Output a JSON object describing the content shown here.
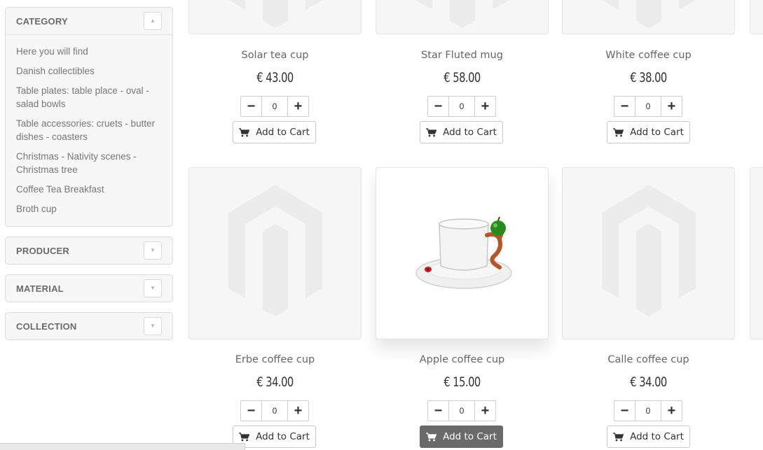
{
  "sidebar": {
    "category": {
      "title": "CATEGORY",
      "items": [
        "Here you will find",
        "Danish collectibles",
        "Table plates: table place - oval - salad bowls",
        "Table accessories: cruets - butter dishes - coasters",
        "Christmas - Nativity scenes - Christmas tree",
        "Coffee Tea Breakfast",
        "Broth cup"
      ]
    },
    "producer": {
      "title": "PRODUCER"
    },
    "material": {
      "title": "MATERIAL"
    },
    "collection": {
      "title": "COLLECTION"
    }
  },
  "products": [
    {
      "name": "Solar tea cup",
      "price": "€ 43.00",
      "qty": "0",
      "cart_label": "Add to Cart"
    },
    {
      "name": "Star Fluted mug",
      "price": "€ 58.00",
      "qty": "0",
      "cart_label": "Add to Cart"
    },
    {
      "name": "White coffee cup",
      "price": "€ 38.00",
      "qty": "0",
      "cart_label": "Add to Cart"
    },
    {
      "name": "Erbe coffee cup",
      "price": "€ 34.00",
      "qty": "0",
      "cart_label": "Add to Cart"
    },
    {
      "name": "Apple coffee cup",
      "price": "€ 15.00",
      "qty": "0",
      "cart_label": "Add to Cart"
    },
    {
      "name": "Calle coffee cup",
      "price": "€ 34.00",
      "qty": "0",
      "cart_label": "Add to Cart"
    }
  ],
  "icons": {
    "collapse": "chevron-up-icon",
    "expand": "chevron-down-icon",
    "cart": "shopping-cart-icon",
    "minus": "minus-icon",
    "plus": "plus-icon"
  },
  "colors": {
    "active_button": "#6a6a6a",
    "panel_bg": "#f7f7f7"
  }
}
